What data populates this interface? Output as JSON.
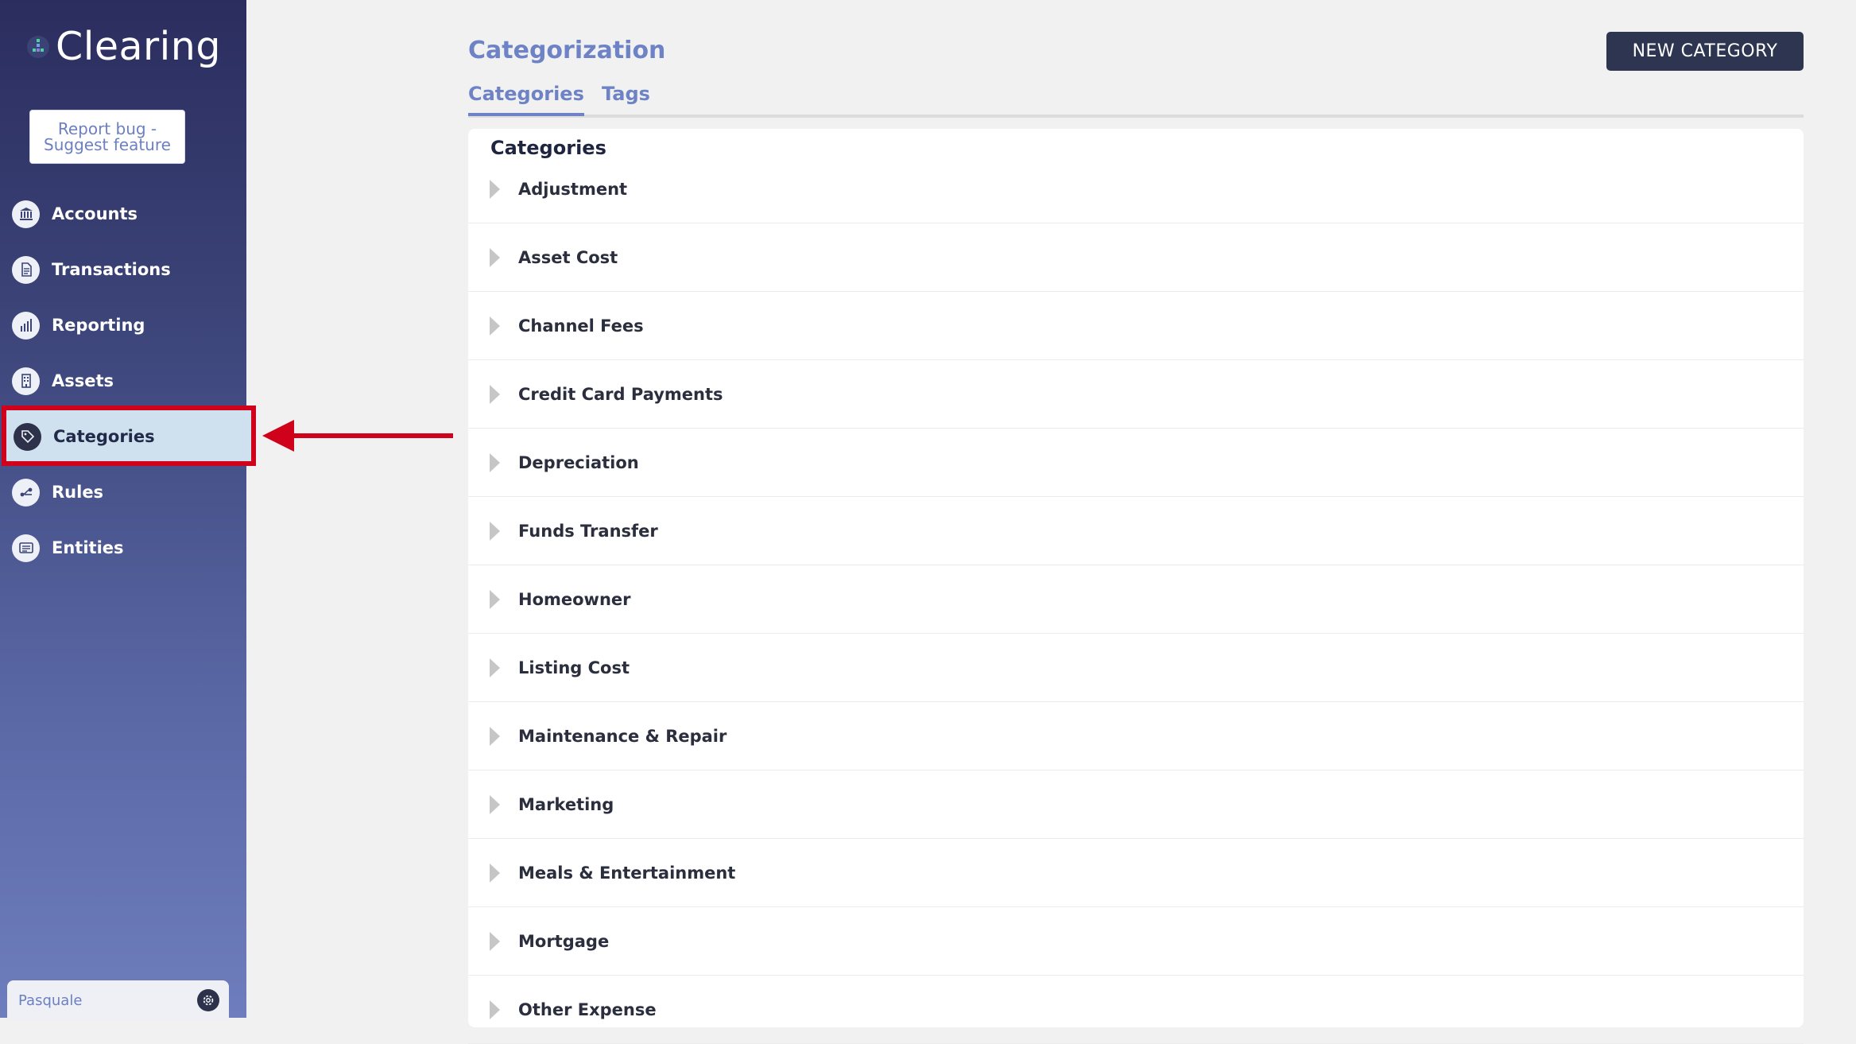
{
  "app": {
    "name": "Clearing",
    "report_button": {
      "line1": "Report bug -",
      "line2": "Suggest feature"
    }
  },
  "sidebar": {
    "items": [
      {
        "label": "Accounts",
        "icon": "bank-icon",
        "active": false
      },
      {
        "label": "Transactions",
        "icon": "document-icon",
        "active": false
      },
      {
        "label": "Reporting",
        "icon": "bar-chart-icon",
        "active": false
      },
      {
        "label": "Assets",
        "icon": "building-icon",
        "active": false
      },
      {
        "label": "Categories",
        "icon": "tag-icon",
        "active": true
      },
      {
        "label": "Rules",
        "icon": "rules-icon",
        "active": false
      },
      {
        "label": "Entities",
        "icon": "list-card-icon",
        "active": false
      }
    ],
    "user": {
      "name": "Pasquale"
    }
  },
  "header": {
    "title": "Categorization",
    "new_button": "NEW CATEGORY",
    "tabs": [
      {
        "label": "Categories",
        "active": true
      },
      {
        "label": "Tags",
        "active": false
      }
    ]
  },
  "panel": {
    "heading": "Categories",
    "rows": [
      "Adjustment",
      "Asset Cost",
      "Channel Fees",
      "Credit Card Payments",
      "Depreciation",
      "Funds Transfer",
      "Homeowner",
      "Listing Cost",
      "Maintenance & Repair",
      "Marketing",
      "Meals & Entertainment",
      "Mortgage",
      "Other Expense"
    ]
  },
  "annotation": {
    "color": "#d0021b"
  },
  "colors": {
    "accent": "#6e83c6",
    "dark": "#2d3550"
  }
}
